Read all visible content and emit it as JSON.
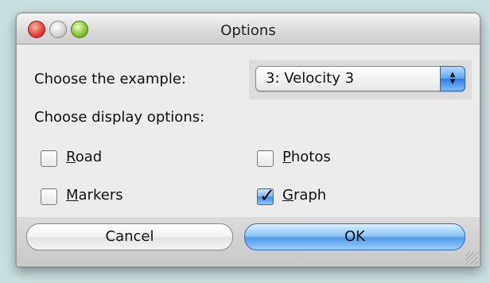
{
  "window": {
    "title": "Options"
  },
  "example": {
    "label": "Choose the example:",
    "selected": "3: Velocity 3"
  },
  "display": {
    "label": "Choose display options:",
    "options": [
      {
        "label_u": "R",
        "label_rest": "oad",
        "checked": false
      },
      {
        "label_u": "P",
        "label_rest": "hotos",
        "checked": false
      },
      {
        "label_u": "M",
        "label_rest": "arkers",
        "checked": false
      },
      {
        "label_u": "G",
        "label_rest": "raph",
        "checked": true
      }
    ]
  },
  "buttons": {
    "cancel": "Cancel",
    "ok": "OK"
  },
  "icons": {
    "close": "close-icon",
    "minimize": "minimize-icon",
    "zoom": "zoom-icon",
    "popup_arrows": "up-down-arrows-icon",
    "checkmark": "checkmark-icon",
    "resize": "resize-grip-icon"
  }
}
